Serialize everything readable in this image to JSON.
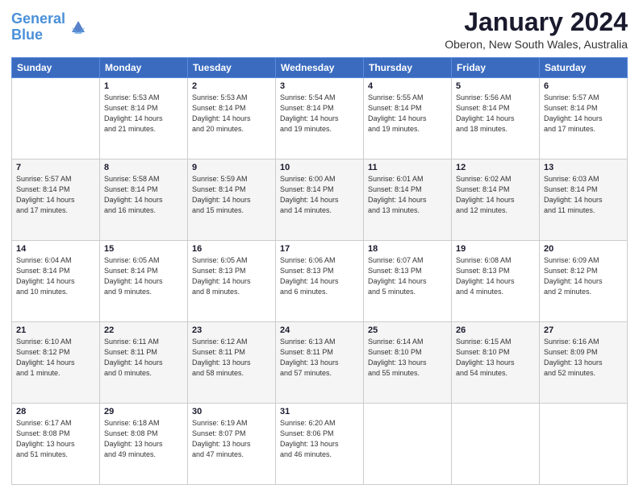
{
  "logo": {
    "line1": "General",
    "line2": "Blue"
  },
  "title": "January 2024",
  "location": "Oberon, New South Wales, Australia",
  "headers": [
    "Sunday",
    "Monday",
    "Tuesday",
    "Wednesday",
    "Thursday",
    "Friday",
    "Saturday"
  ],
  "weeks": [
    [
      {
        "day": "",
        "info": ""
      },
      {
        "day": "1",
        "info": "Sunrise: 5:53 AM\nSunset: 8:14 PM\nDaylight: 14 hours\nand 21 minutes."
      },
      {
        "day": "2",
        "info": "Sunrise: 5:53 AM\nSunset: 8:14 PM\nDaylight: 14 hours\nand 20 minutes."
      },
      {
        "day": "3",
        "info": "Sunrise: 5:54 AM\nSunset: 8:14 PM\nDaylight: 14 hours\nand 19 minutes."
      },
      {
        "day": "4",
        "info": "Sunrise: 5:55 AM\nSunset: 8:14 PM\nDaylight: 14 hours\nand 19 minutes."
      },
      {
        "day": "5",
        "info": "Sunrise: 5:56 AM\nSunset: 8:14 PM\nDaylight: 14 hours\nand 18 minutes."
      },
      {
        "day": "6",
        "info": "Sunrise: 5:57 AM\nSunset: 8:14 PM\nDaylight: 14 hours\nand 17 minutes."
      }
    ],
    [
      {
        "day": "7",
        "info": "Sunrise: 5:57 AM\nSunset: 8:14 PM\nDaylight: 14 hours\nand 17 minutes."
      },
      {
        "day": "8",
        "info": "Sunrise: 5:58 AM\nSunset: 8:14 PM\nDaylight: 14 hours\nand 16 minutes."
      },
      {
        "day": "9",
        "info": "Sunrise: 5:59 AM\nSunset: 8:14 PM\nDaylight: 14 hours\nand 15 minutes."
      },
      {
        "day": "10",
        "info": "Sunrise: 6:00 AM\nSunset: 8:14 PM\nDaylight: 14 hours\nand 14 minutes."
      },
      {
        "day": "11",
        "info": "Sunrise: 6:01 AM\nSunset: 8:14 PM\nDaylight: 14 hours\nand 13 minutes."
      },
      {
        "day": "12",
        "info": "Sunrise: 6:02 AM\nSunset: 8:14 PM\nDaylight: 14 hours\nand 12 minutes."
      },
      {
        "day": "13",
        "info": "Sunrise: 6:03 AM\nSunset: 8:14 PM\nDaylight: 14 hours\nand 11 minutes."
      }
    ],
    [
      {
        "day": "14",
        "info": "Sunrise: 6:04 AM\nSunset: 8:14 PM\nDaylight: 14 hours\nand 10 minutes."
      },
      {
        "day": "15",
        "info": "Sunrise: 6:05 AM\nSunset: 8:14 PM\nDaylight: 14 hours\nand 9 minutes."
      },
      {
        "day": "16",
        "info": "Sunrise: 6:05 AM\nSunset: 8:13 PM\nDaylight: 14 hours\nand 8 minutes."
      },
      {
        "day": "17",
        "info": "Sunrise: 6:06 AM\nSunset: 8:13 PM\nDaylight: 14 hours\nand 6 minutes."
      },
      {
        "day": "18",
        "info": "Sunrise: 6:07 AM\nSunset: 8:13 PM\nDaylight: 14 hours\nand 5 minutes."
      },
      {
        "day": "19",
        "info": "Sunrise: 6:08 AM\nSunset: 8:13 PM\nDaylight: 14 hours\nand 4 minutes."
      },
      {
        "day": "20",
        "info": "Sunrise: 6:09 AM\nSunset: 8:12 PM\nDaylight: 14 hours\nand 2 minutes."
      }
    ],
    [
      {
        "day": "21",
        "info": "Sunrise: 6:10 AM\nSunset: 8:12 PM\nDaylight: 14 hours\nand 1 minute."
      },
      {
        "day": "22",
        "info": "Sunrise: 6:11 AM\nSunset: 8:11 PM\nDaylight: 14 hours\nand 0 minutes."
      },
      {
        "day": "23",
        "info": "Sunrise: 6:12 AM\nSunset: 8:11 PM\nDaylight: 13 hours\nand 58 minutes."
      },
      {
        "day": "24",
        "info": "Sunrise: 6:13 AM\nSunset: 8:11 PM\nDaylight: 13 hours\nand 57 minutes."
      },
      {
        "day": "25",
        "info": "Sunrise: 6:14 AM\nSunset: 8:10 PM\nDaylight: 13 hours\nand 55 minutes."
      },
      {
        "day": "26",
        "info": "Sunrise: 6:15 AM\nSunset: 8:10 PM\nDaylight: 13 hours\nand 54 minutes."
      },
      {
        "day": "27",
        "info": "Sunrise: 6:16 AM\nSunset: 8:09 PM\nDaylight: 13 hours\nand 52 minutes."
      }
    ],
    [
      {
        "day": "28",
        "info": "Sunrise: 6:17 AM\nSunset: 8:08 PM\nDaylight: 13 hours\nand 51 minutes."
      },
      {
        "day": "29",
        "info": "Sunrise: 6:18 AM\nSunset: 8:08 PM\nDaylight: 13 hours\nand 49 minutes."
      },
      {
        "day": "30",
        "info": "Sunrise: 6:19 AM\nSunset: 8:07 PM\nDaylight: 13 hours\nand 47 minutes."
      },
      {
        "day": "31",
        "info": "Sunrise: 6:20 AM\nSunset: 8:06 PM\nDaylight: 13 hours\nand 46 minutes."
      },
      {
        "day": "",
        "info": ""
      },
      {
        "day": "",
        "info": ""
      },
      {
        "day": "",
        "info": ""
      }
    ]
  ]
}
